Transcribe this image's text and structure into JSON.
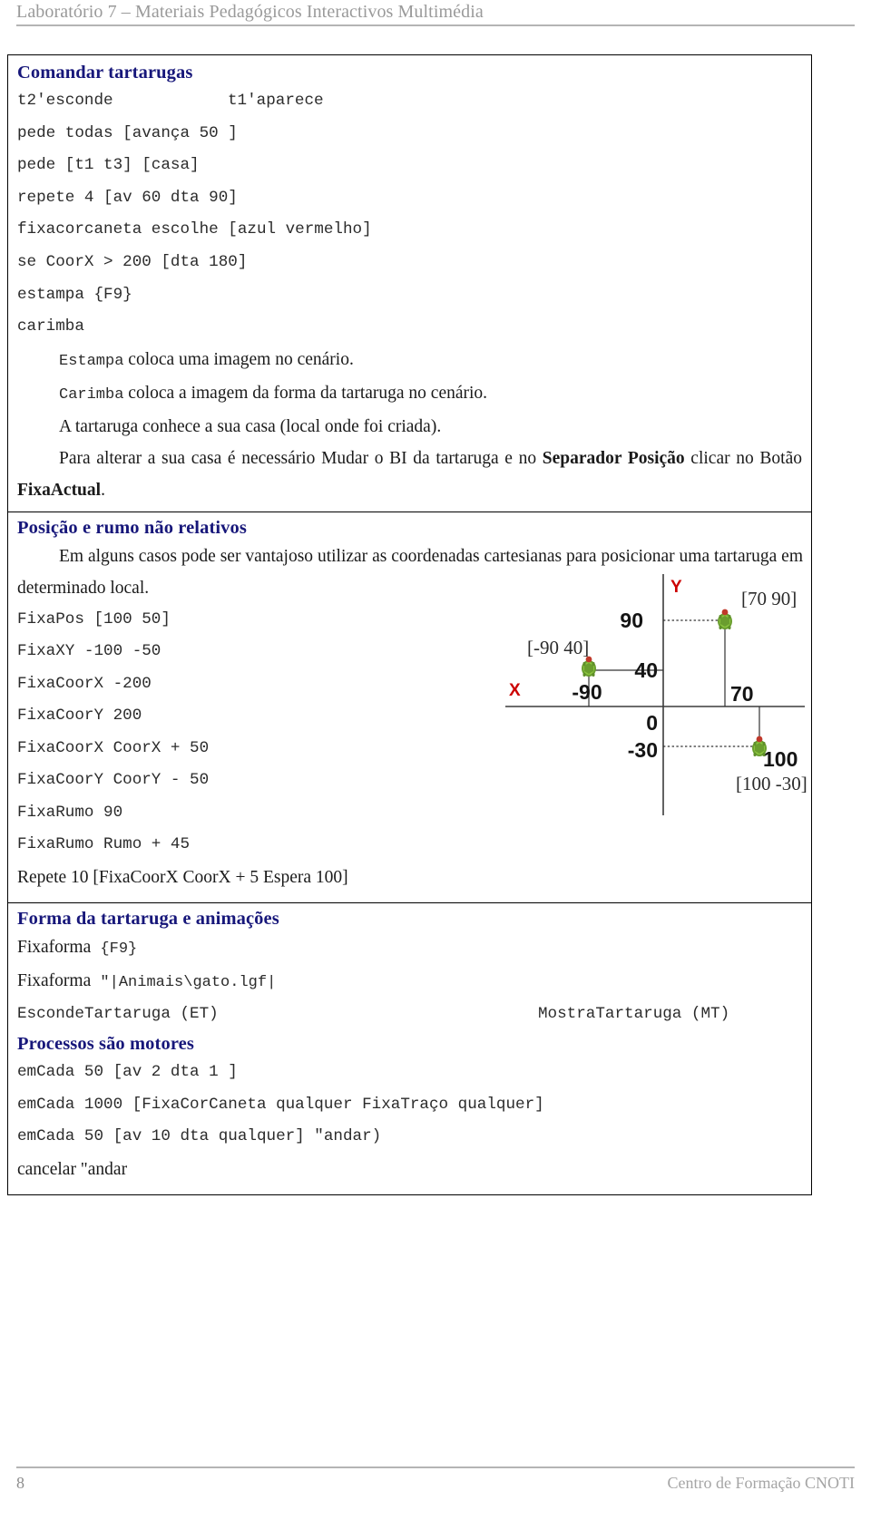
{
  "header": {
    "title": "Laboratório 7 – Materiais Pedagógicos Interactivos Multimédia"
  },
  "footer": {
    "page_number": "8",
    "organization": "Centro de Formação CNOTI"
  },
  "sections": {
    "comandar": {
      "heading": "Comandar tartarugas",
      "code_line_1_left": "t2'esconde",
      "code_line_1_right": "t1'aparece",
      "code_lines": [
        "pede todas [avança 50 ]",
        "pede [t1 t3] [casa]",
        "repete 4 [av 60 dta 90]",
        "fixacorcaneta escolhe [azul vermelho]",
        "se CoorX > 200 [dta 180]",
        "estampa {F9}",
        "carimba"
      ],
      "para_1_mono": "Estampa",
      "para_1_rest": " coloca uma imagem no cenário.",
      "para_2_mono": "Carimba",
      "para_2_rest": " coloca a imagem da forma da tartaruga no cenário.",
      "para_3": "A tartaruga conhece a sua casa (local onde foi criada).",
      "para_4_a": "Para alterar a sua casa é necessário Mudar o BI da tartaruga e no ",
      "para_4_b1": "Separador Posição",
      "para_4_c": " clicar no Botão ",
      "para_4_b2": "FixaActual",
      "para_4_d": "."
    },
    "posicao": {
      "heading": "Posição e rumo não relativos",
      "paragraph": "Em alguns casos pode ser vantajoso utilizar as coordenadas cartesianas para posicionar uma tartaruga em determinado local.",
      "code_lines": [
        "FixaPos [100 50]",
        "FixaXY -100 -50",
        "FixaCoorX -200",
        "FixaCoorY 200",
        "FixaCoorX CoorX + 50",
        "FixaCoorY CoorY - 50",
        "FixaRumo 90",
        "FixaRumo Rumo + 45"
      ],
      "serif_line": "Repete 10 [FixaCoorX CoorX + 5 Espera 100]"
    },
    "forma": {
      "heading": "Forma da tartaruga e animações",
      "line_1_serif": "Fixaforma",
      "line_1_mono": " {F9}",
      "line_2_serif": "Fixaforma",
      "line_2_mono": " \"|Animais\\gato.lgf|",
      "line_3_left": "EscondeTartaruga (ET)",
      "line_3_right": "MostraTartaruga (MT)"
    },
    "processos": {
      "heading": "Processos são motores",
      "code_lines": [
        "emCada 50 [av 2 dta 1 ]",
        "emCada 1000 [FixaCorCaneta qualquer FixaTraço qualquer]",
        "emCada 50 [av 10 dta qualquer] \"andar)"
      ],
      "serif_line": "cancelar \"andar"
    }
  },
  "chart_data": {
    "type": "scatter",
    "title": "",
    "xlabel": "X",
    "ylabel": "Y",
    "axis_labels": {
      "x": "X",
      "y": "Y"
    },
    "origin_label": "0",
    "y_ticks": [
      "90",
      "40",
      "0",
      "-30"
    ],
    "x_ticks": [
      "-90",
      "70",
      "100"
    ],
    "points": [
      {
        "label": "[-90 40]",
        "x": -90,
        "y": 40,
        "icon": "turtle-icon"
      },
      {
        "label": "[70 90]",
        "x": 70,
        "y": 90,
        "icon": "turtle-icon"
      },
      {
        "label": "[100 -30]",
        "x": 100,
        "y": -30,
        "icon": "turtle-icon"
      }
    ],
    "axis_color": "#cc0000",
    "grid": false,
    "legend": "none"
  }
}
